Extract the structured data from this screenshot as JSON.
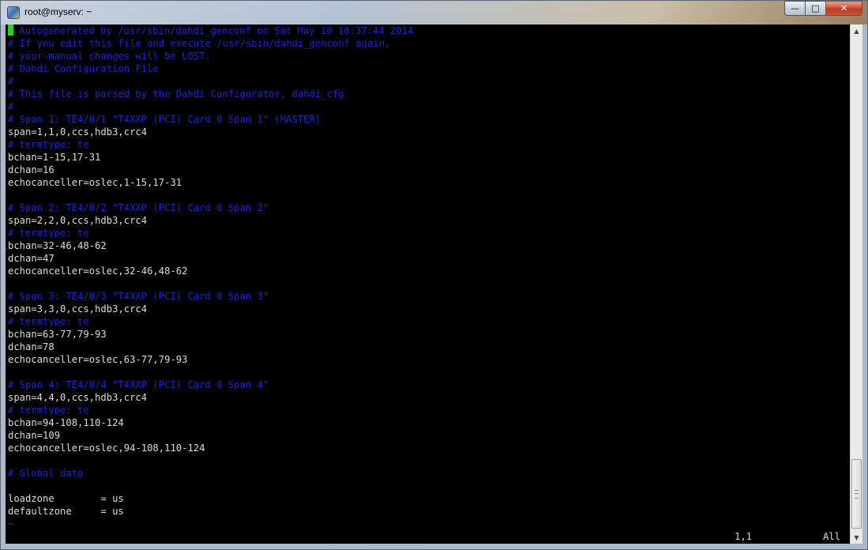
{
  "window": {
    "title": "root@myserv: ~",
    "minimize_glyph": "—",
    "maximize_glyph": "□",
    "close_glyph": "✕"
  },
  "terminal": {
    "lines": [
      {
        "text": " Autogenerated by /usr/sbin/dahdi_genconf on Sat May 10 18:37:44 2014",
        "type": "comment",
        "cursor": true
      },
      {
        "text": "# If you edit this file and execute /usr/sbin/dahdi_genconf again,",
        "type": "comment"
      },
      {
        "text": "# your manual changes will be LOST.",
        "type": "comment"
      },
      {
        "text": "# Dahdi Configuration File",
        "type": "comment"
      },
      {
        "text": "#",
        "type": "comment"
      },
      {
        "text": "# This file is parsed by the Dahdi Configurator, dahdi_cfg",
        "type": "comment"
      },
      {
        "text": "#",
        "type": "comment"
      },
      {
        "text": "# Span 1: TE4/0/1 \"T4XXP (PCI) Card 0 Span 1\" (MASTER)",
        "type": "comment"
      },
      {
        "text": "span=1,1,0,ccs,hdb3,crc4",
        "type": "text"
      },
      {
        "text": "# termtype: te",
        "type": "comment"
      },
      {
        "text": "bchan=1-15,17-31",
        "type": "text"
      },
      {
        "text": "dchan=16",
        "type": "text"
      },
      {
        "text": "echocanceller=oslec,1-15,17-31",
        "type": "text"
      },
      {
        "text": "",
        "type": "text"
      },
      {
        "text": "# Span 2: TE4/0/2 \"T4XXP (PCI) Card 0 Span 2\"",
        "type": "comment"
      },
      {
        "text": "span=2,2,0,ccs,hdb3,crc4",
        "type": "text"
      },
      {
        "text": "# termtype: te",
        "type": "comment"
      },
      {
        "text": "bchan=32-46,48-62",
        "type": "text"
      },
      {
        "text": "dchan=47",
        "type": "text"
      },
      {
        "text": "echocanceller=oslec,32-46,48-62",
        "type": "text"
      },
      {
        "text": "",
        "type": "text"
      },
      {
        "text": "# Span 3: TE4/0/3 \"T4XXP (PCI) Card 0 Span 3\"",
        "type": "comment"
      },
      {
        "text": "span=3,3,0,ccs,hdb3,crc4",
        "type": "text"
      },
      {
        "text": "# termtype: te",
        "type": "comment"
      },
      {
        "text": "bchan=63-77,79-93",
        "type": "text"
      },
      {
        "text": "dchan=78",
        "type": "text"
      },
      {
        "text": "echocanceller=oslec,63-77,79-93",
        "type": "text"
      },
      {
        "text": "",
        "type": "text"
      },
      {
        "text": "# Span 4: TE4/0/4 \"T4XXP (PCI) Card 0 Span 4\"",
        "type": "comment"
      },
      {
        "text": "span=4,4,0,ccs,hdb3,crc4",
        "type": "text"
      },
      {
        "text": "# termtype: te",
        "type": "comment"
      },
      {
        "text": "bchan=94-108,110-124",
        "type": "text"
      },
      {
        "text": "dchan=109",
        "type": "text"
      },
      {
        "text": "echocanceller=oslec,94-108,110-124",
        "type": "text"
      },
      {
        "text": "",
        "type": "text"
      },
      {
        "text": "# Global data",
        "type": "comment"
      },
      {
        "text": "",
        "type": "text"
      },
      {
        "text": "loadzone        = us",
        "type": "text"
      },
      {
        "text": "defaultzone     = us",
        "type": "text"
      },
      {
        "text": "~",
        "type": "tilde"
      }
    ],
    "status_position": "1,1",
    "status_scroll": "All"
  },
  "scrollbar": {
    "up_icon": "▲",
    "down_icon": "▼"
  },
  "colors": {
    "background": "#000000",
    "text": "#dcdcdc",
    "comment": "#1f25c9",
    "cursor": "#2bd12b"
  }
}
